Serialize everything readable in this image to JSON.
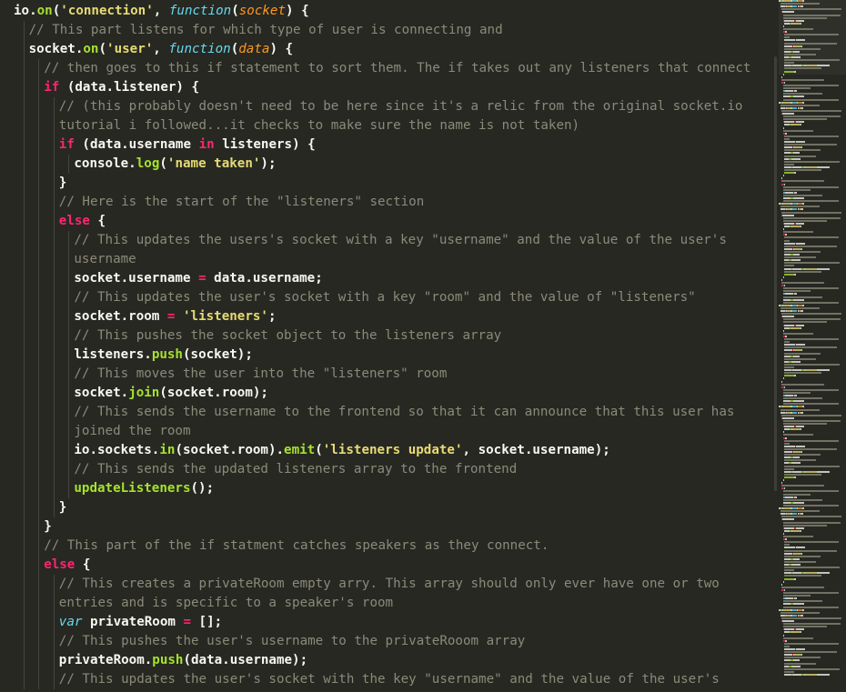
{
  "editor": {
    "colors": {
      "background": "#272822",
      "text": "#f8f8f2",
      "keyword": "#f92672",
      "function": "#a6e22e",
      "string": "#e6db74",
      "storage": "#66d9ef",
      "parameter": "#fd971f",
      "comment": "#8b8a79"
    },
    "lines": [
      {
        "indent": 0,
        "tokens": [
          [
            "id",
            "io."
          ],
          [
            "fn",
            "on"
          ],
          [
            "pu",
            "("
          ],
          [
            "st",
            "'connection'"
          ],
          [
            "pu",
            ", "
          ],
          [
            "sk",
            "function"
          ],
          [
            "pu",
            "("
          ],
          [
            "pa",
            "socket"
          ],
          [
            "pu",
            ") {"
          ]
        ]
      },
      {
        "indent": 1,
        "tokens": [
          [
            "cm",
            "// This part listens for which type of user is connecting and"
          ]
        ]
      },
      {
        "indent": 1,
        "tokens": [
          [
            "id",
            "socket."
          ],
          [
            "fn",
            "on"
          ],
          [
            "pu",
            "("
          ],
          [
            "st",
            "'user'"
          ],
          [
            "pu",
            ", "
          ],
          [
            "sk",
            "function"
          ],
          [
            "pu",
            "("
          ],
          [
            "pa",
            "data"
          ],
          [
            "pu",
            ") {"
          ]
        ]
      },
      {
        "indent": 2,
        "tokens": [
          [
            "cm",
            "// then goes to this if statement to sort them. The if takes out any listeners that connect"
          ]
        ]
      },
      {
        "indent": 2,
        "tokens": [
          [
            "kw",
            "if"
          ],
          [
            "pu",
            " (data.listener) {"
          ]
        ]
      },
      {
        "indent": 3,
        "tokens": [
          [
            "cm",
            "// (this probably doesn't need to be here since it's a relic from the original socket.io"
          ]
        ]
      },
      {
        "indent": 3,
        "tokens": [
          [
            "cm",
            "tutorial i followed...it checks to make sure the name is not taken)"
          ]
        ]
      },
      {
        "indent": 3,
        "tokens": [
          [
            "kw",
            "if"
          ],
          [
            "pu",
            " (data.username "
          ],
          [
            "kw",
            "in"
          ],
          [
            "pu",
            " listeners) {"
          ]
        ]
      },
      {
        "indent": 4,
        "tokens": [
          [
            "id",
            "console."
          ],
          [
            "fn",
            "log"
          ],
          [
            "pu",
            "("
          ],
          [
            "st",
            "'name taken'"
          ],
          [
            "pu",
            ");"
          ]
        ]
      },
      {
        "indent": 3,
        "tokens": [
          [
            "pu",
            "}"
          ]
        ]
      },
      {
        "indent": 3,
        "tokens": [
          [
            "cm",
            "// Here is the start of the \"listeners\" section"
          ]
        ]
      },
      {
        "indent": 3,
        "tokens": [
          [
            "kw",
            "else"
          ],
          [
            "pu",
            " {"
          ]
        ]
      },
      {
        "indent": 4,
        "tokens": [
          [
            "cm",
            "// This updates the users's socket with a key \"username\" and the value of the user's"
          ]
        ]
      },
      {
        "indent": 4,
        "tokens": [
          [
            "cm",
            "username"
          ]
        ]
      },
      {
        "indent": 4,
        "tokens": [
          [
            "id",
            "socket.username "
          ],
          [
            "kw",
            "="
          ],
          [
            "pu",
            " data.username;"
          ]
        ]
      },
      {
        "indent": 4,
        "tokens": [
          [
            "cm",
            "// This updates the user's socket with a key \"room\" and the value of \"listeners\""
          ]
        ]
      },
      {
        "indent": 4,
        "tokens": [
          [
            "id",
            "socket.room "
          ],
          [
            "kw",
            "="
          ],
          [
            "pu",
            " "
          ],
          [
            "st",
            "'listeners'"
          ],
          [
            "pu",
            ";"
          ]
        ]
      },
      {
        "indent": 4,
        "tokens": [
          [
            "cm",
            "// This pushes the socket object to the listeners array"
          ]
        ]
      },
      {
        "indent": 4,
        "tokens": [
          [
            "id",
            "listeners."
          ],
          [
            "fn",
            "push"
          ],
          [
            "pu",
            "(socket);"
          ]
        ]
      },
      {
        "indent": 4,
        "tokens": [
          [
            "cm",
            "// This moves the user into the \"listeners\" room"
          ]
        ]
      },
      {
        "indent": 4,
        "tokens": [
          [
            "id",
            "socket."
          ],
          [
            "fn",
            "join"
          ],
          [
            "pu",
            "(socket.room);"
          ]
        ]
      },
      {
        "indent": 4,
        "tokens": [
          [
            "cm",
            "// This sends the username to the frontend so that it can announce that this user has"
          ]
        ]
      },
      {
        "indent": 4,
        "tokens": [
          [
            "cm",
            "joined the room"
          ]
        ]
      },
      {
        "indent": 4,
        "tokens": [
          [
            "id",
            "io.sockets."
          ],
          [
            "fn",
            "in"
          ],
          [
            "pu",
            "(socket.room)."
          ],
          [
            "fn",
            "emit"
          ],
          [
            "pu",
            "("
          ],
          [
            "st",
            "'listeners update'"
          ],
          [
            "pu",
            ", socket.username);"
          ]
        ]
      },
      {
        "indent": 4,
        "tokens": [
          [
            "cm",
            "// This sends the updated listeners array to the frontend"
          ]
        ]
      },
      {
        "indent": 4,
        "tokens": [
          [
            "fn",
            "updateListeners"
          ],
          [
            "pu",
            "();"
          ]
        ]
      },
      {
        "indent": 3,
        "tokens": [
          [
            "pu",
            "}"
          ]
        ]
      },
      {
        "indent": 2,
        "tokens": [
          [
            "pu",
            "}"
          ]
        ]
      },
      {
        "indent": 2,
        "tokens": [
          [
            "cm",
            "// This part of the if statment catches speakers as they connect."
          ]
        ]
      },
      {
        "indent": 2,
        "tokens": [
          [
            "kw",
            "else"
          ],
          [
            "pu",
            " {"
          ]
        ]
      },
      {
        "indent": 3,
        "tokens": [
          [
            "cm",
            "// This creates a privateRoom empty arry. This array should only ever have one or two"
          ]
        ]
      },
      {
        "indent": 3,
        "tokens": [
          [
            "cm",
            "entries and is specific to a speaker's room"
          ]
        ]
      },
      {
        "indent": 3,
        "tokens": [
          [
            "sk",
            "var"
          ],
          [
            "pu",
            " privateRoom "
          ],
          [
            "kw",
            "="
          ],
          [
            "pu",
            " [];"
          ]
        ]
      },
      {
        "indent": 3,
        "tokens": [
          [
            "cm",
            "// This pushes the user's username to the privateRooom array"
          ]
        ]
      },
      {
        "indent": 3,
        "tokens": [
          [
            "id",
            "privateRoom."
          ],
          [
            "fn",
            "push"
          ],
          [
            "pu",
            "(data.username);"
          ]
        ]
      },
      {
        "indent": 3,
        "tokens": [
          [
            "cm",
            "// This updates the user's socket with the key \"username\" and the value of the user's"
          ]
        ]
      }
    ]
  }
}
